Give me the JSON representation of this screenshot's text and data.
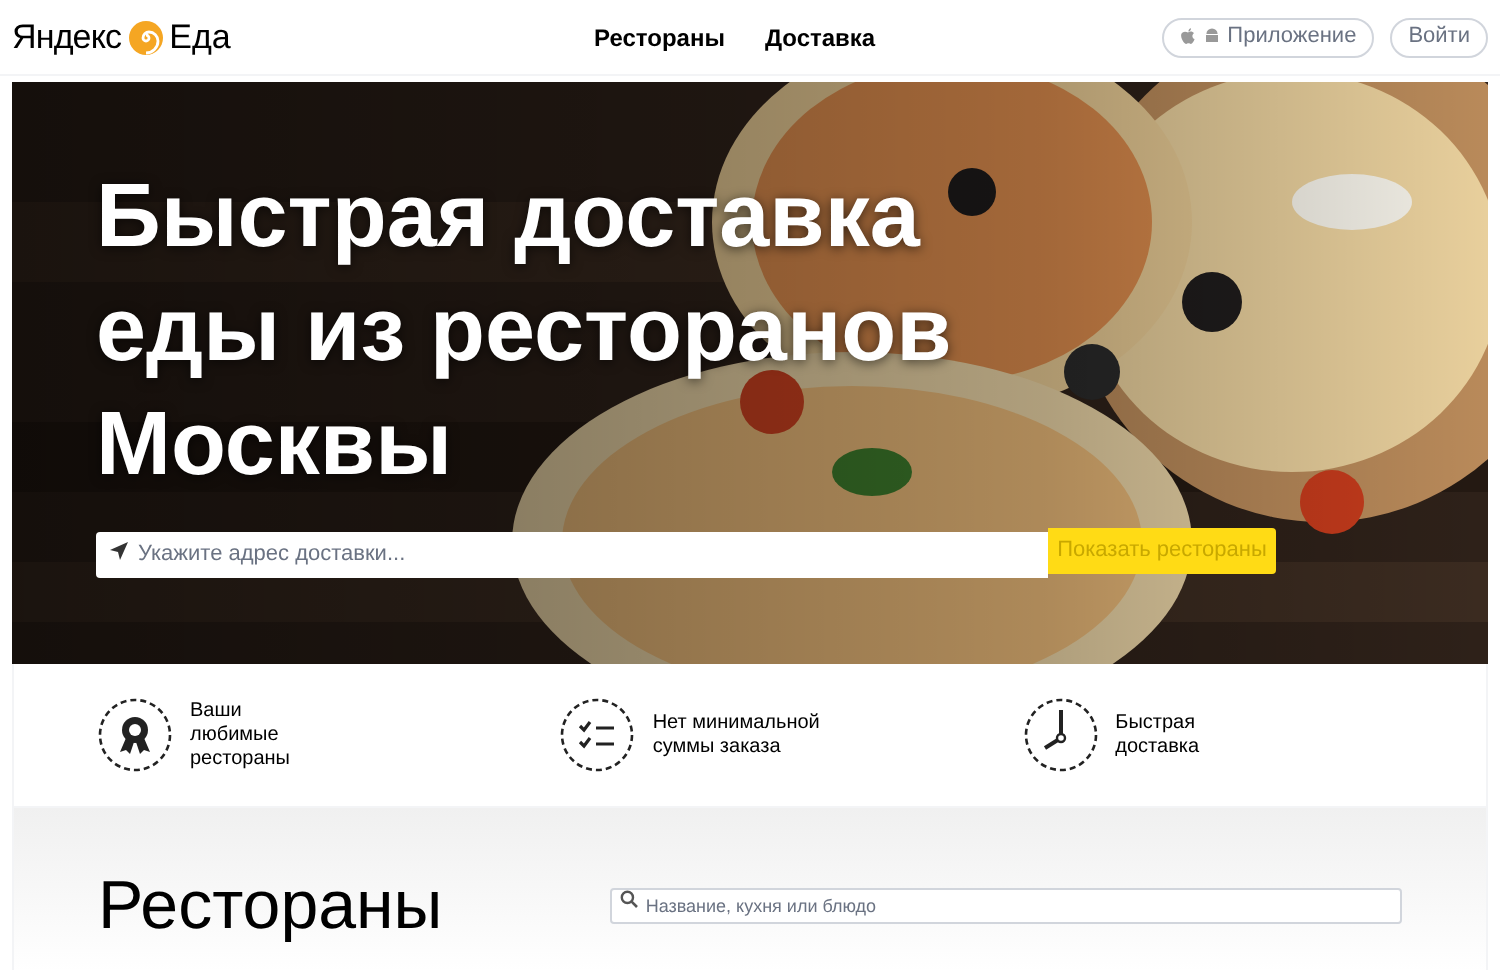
{
  "header": {
    "logo": {
      "brand": "Яндекс",
      "product": "Еда"
    },
    "nav": [
      {
        "label": "Рестораны"
      },
      {
        "label": "Доставка"
      }
    ],
    "app_button": "Приложение",
    "login_button": "Войти"
  },
  "hero": {
    "kind": "picture",
    "title": "Быстрая доставка\nеды из ресторанов\nМосквы",
    "address_placeholder": "Укажите адрес доставки...",
    "submit_button": "Показать рестораны"
  },
  "features": [
    {
      "kind": "medal",
      "text": "Ваши\nлюбимые\nрестораны"
    },
    {
      "kind": "checklist",
      "text": "Нет минимальной\nсуммы заказа"
    },
    {
      "kind": "clock",
      "text": "Быстрая\nдоставка"
    }
  ],
  "restaurants": {
    "title": "Рестораны",
    "search_placeholder": "Название, кухня или блюдо"
  }
}
